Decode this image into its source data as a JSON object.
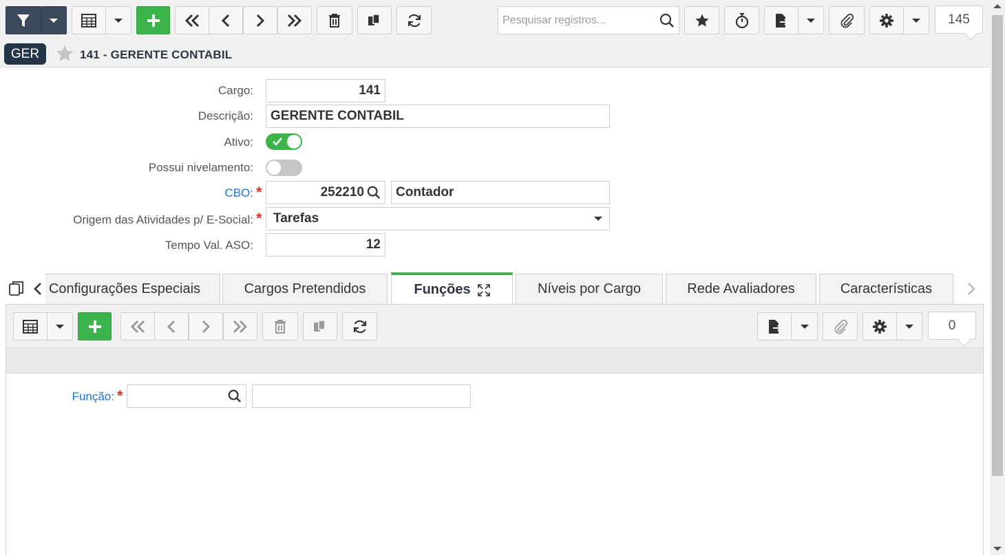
{
  "toolbar": {
    "search_placeholder": "Pesquisar registros...",
    "record_count": "145"
  },
  "header": {
    "badge": "GER",
    "title": "141 - GERENTE CONTABIL"
  },
  "form": {
    "cargo_label": "Cargo:",
    "cargo_value": "141",
    "descricao_label": "Descrição:",
    "descricao_value": "GERENTE CONTABIL",
    "ativo_label": "Ativo:",
    "ativo_on": true,
    "nivelamento_label": "Possui nivelamento:",
    "nivelamento_on": false,
    "cbo_label": "CBO:",
    "cbo_code": "252210",
    "cbo_desc": "Contador",
    "origem_label": "Origem das Atividades p/ E-Social:",
    "origem_value": "Tarefas",
    "tempo_label": "Tempo Val. ASO:",
    "tempo_value": "12",
    "required_mark": "*"
  },
  "tabs": [
    {
      "label": "Configurações Especiais"
    },
    {
      "label": "Cargos Pretendidos"
    },
    {
      "label": "Funções",
      "active": true
    },
    {
      "label": "Níveis por Cargo"
    },
    {
      "label": "Rede Avaliadores"
    },
    {
      "label": "Características"
    }
  ],
  "subpanel": {
    "record_count": "0",
    "funcao_label": "Função:",
    "funcao_code": "",
    "funcao_desc": ""
  },
  "colors": {
    "accent_green": "#3cb44b",
    "dark_button": "#3a4a5c",
    "link_blue": "#1e74d6",
    "required_red": "#d9352f"
  }
}
